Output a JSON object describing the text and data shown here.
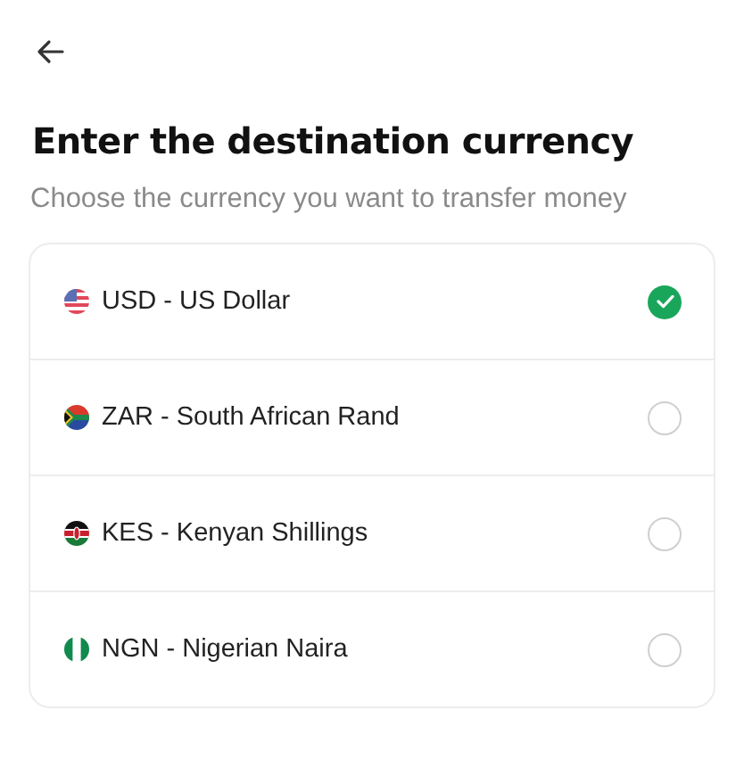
{
  "title": "Enter the destination currency",
  "subtitle": "Choose the currency you want to transfer money",
  "currencies": [
    {
      "kind": "us",
      "label": "USD - US Dollar",
      "selected": true
    },
    {
      "kind": "za",
      "label": "ZAR - South African Rand",
      "selected": false
    },
    {
      "kind": "ke",
      "label": "KES - Kenyan Shillings",
      "selected": false
    },
    {
      "kind": "ng",
      "label": "NGN - Nigerian Naira",
      "selected": false
    }
  ]
}
